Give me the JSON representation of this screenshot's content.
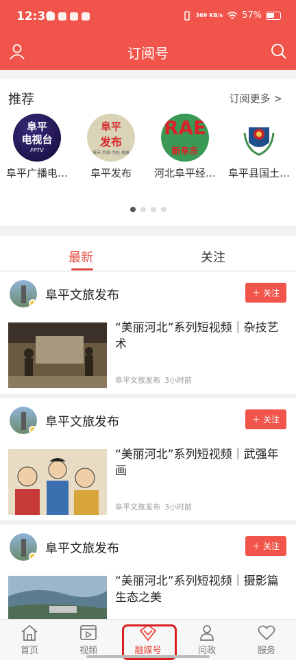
{
  "status_bar": {
    "time": "12:36",
    "network_speed": "369 KB/s",
    "battery": "57%"
  },
  "header": {
    "title": "订阅号"
  },
  "recommend": {
    "title": "推荐",
    "more_label": "订阅更多 >",
    "items": [
      {
        "name": "阜平广播电…",
        "logo_line1": "阜平",
        "logo_line2": "电视台",
        "logo_line3": "FPTV"
      },
      {
        "name": "阜平发布",
        "logo_line1": "阜平",
        "logo_line2": "发布",
        "logo_line3": "城市·百家·为民·发展"
      },
      {
        "name": "河北阜平经…",
        "logo_line1": "RAE",
        "logo_line2": "新阜东",
        "logo_line3": ""
      },
      {
        "name": "阜平县国土…",
        "logo_line1": "",
        "logo_line2": "",
        "logo_line3": ""
      }
    ],
    "page_count": 4,
    "active_page": 1
  },
  "tabs": [
    {
      "label": "最新",
      "active": true
    },
    {
      "label": "关注",
      "active": false
    }
  ],
  "feed": [
    {
      "author": "阜平文旅发布",
      "follow_label": "关注",
      "headline": "“美丽河北”系列短视频｜杂技艺术",
      "source": "阜平文旅发布",
      "time_ago": "3小时前"
    },
    {
      "author": "阜平文旅发布",
      "follow_label": "关注",
      "headline": "“美丽河北”系列短视频｜武强年画",
      "source": "阜平文旅发布",
      "time_ago": "3小时前"
    },
    {
      "author": "阜平文旅发布",
      "follow_label": "关注",
      "headline": "“美丽河北”系列短视频｜摄影篇生态之美",
      "source": "",
      "time_ago": ""
    }
  ],
  "bottom_nav": [
    {
      "label": "首页",
      "icon": "home-icon",
      "active": false
    },
    {
      "label": "视频",
      "icon": "video-icon",
      "active": false
    },
    {
      "label": "融媒号",
      "icon": "media-icon",
      "active": true
    },
    {
      "label": "问政",
      "icon": "question-icon",
      "active": false
    },
    {
      "label": "服务",
      "icon": "heart-icon",
      "active": false
    }
  ],
  "colors": {
    "brand": "#f1544a",
    "active_text": "#e5483f"
  }
}
